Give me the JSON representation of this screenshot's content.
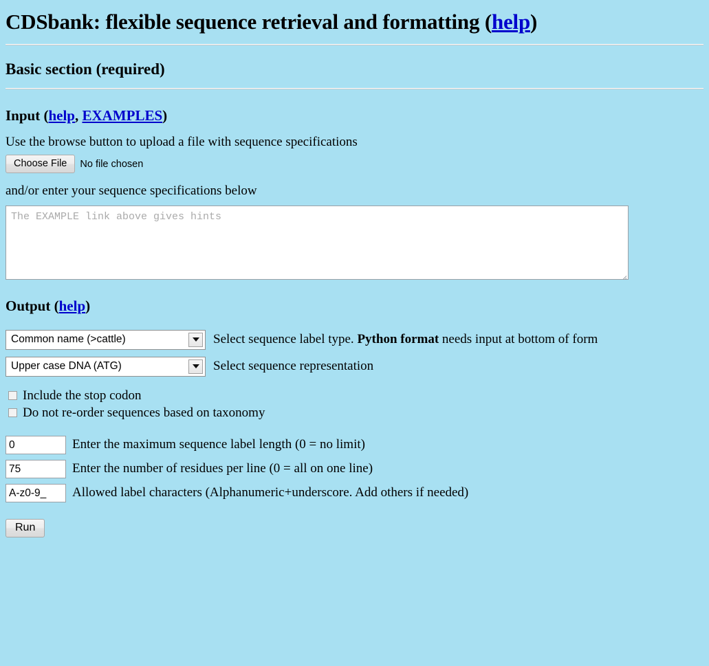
{
  "page": {
    "background_color": "#a8e0f2",
    "link_color": "#0000cc",
    "title_prefix": "CDSbank: flexible sequence retrieval and formatting (",
    "title_help": "help",
    "title_suffix": ")"
  },
  "basic_section": {
    "heading": "Basic section (required)"
  },
  "input_section": {
    "heading_prefix": "Input (",
    "help_label": "help",
    "separator": ", ",
    "examples_label": "EXAMPLES",
    "heading_suffix": ")",
    "browse_instruction": "Use the browse button to upload a file with sequence specifications",
    "choose_file_label": "Choose File",
    "file_status": "No file chosen",
    "textarea_instruction": "and/or enter your sequence specifications below",
    "textarea_placeholder": "The EXAMPLE link above gives hints",
    "textarea_value": ""
  },
  "output_section": {
    "heading_prefix": "Output (",
    "help_label": "help",
    "heading_suffix": ")",
    "label_type_select": {
      "value": "Common name (>cattle)",
      "description_before": "Select sequence label type. ",
      "description_bold": "Python format",
      "description_after": " needs input at bottom of form"
    },
    "representation_select": {
      "value": "Upper case DNA (ATG)",
      "description": "Select sequence representation"
    },
    "checkboxes": [
      {
        "label": "Include the stop codon",
        "checked": false
      },
      {
        "label": "Do not re-order sequences based on taxonomy",
        "checked": false
      }
    ],
    "text_inputs": [
      {
        "value": "0",
        "label": "Enter the maximum sequence label length (0 = no limit)"
      },
      {
        "value": "75",
        "label": "Enter the number of residues per line (0 = all on one line)"
      },
      {
        "value": "A-z0-9_",
        "label": "Allowed label characters (Alphanumeric+underscore. Add others if needed)"
      }
    ]
  },
  "actions": {
    "run_label": "Run"
  }
}
